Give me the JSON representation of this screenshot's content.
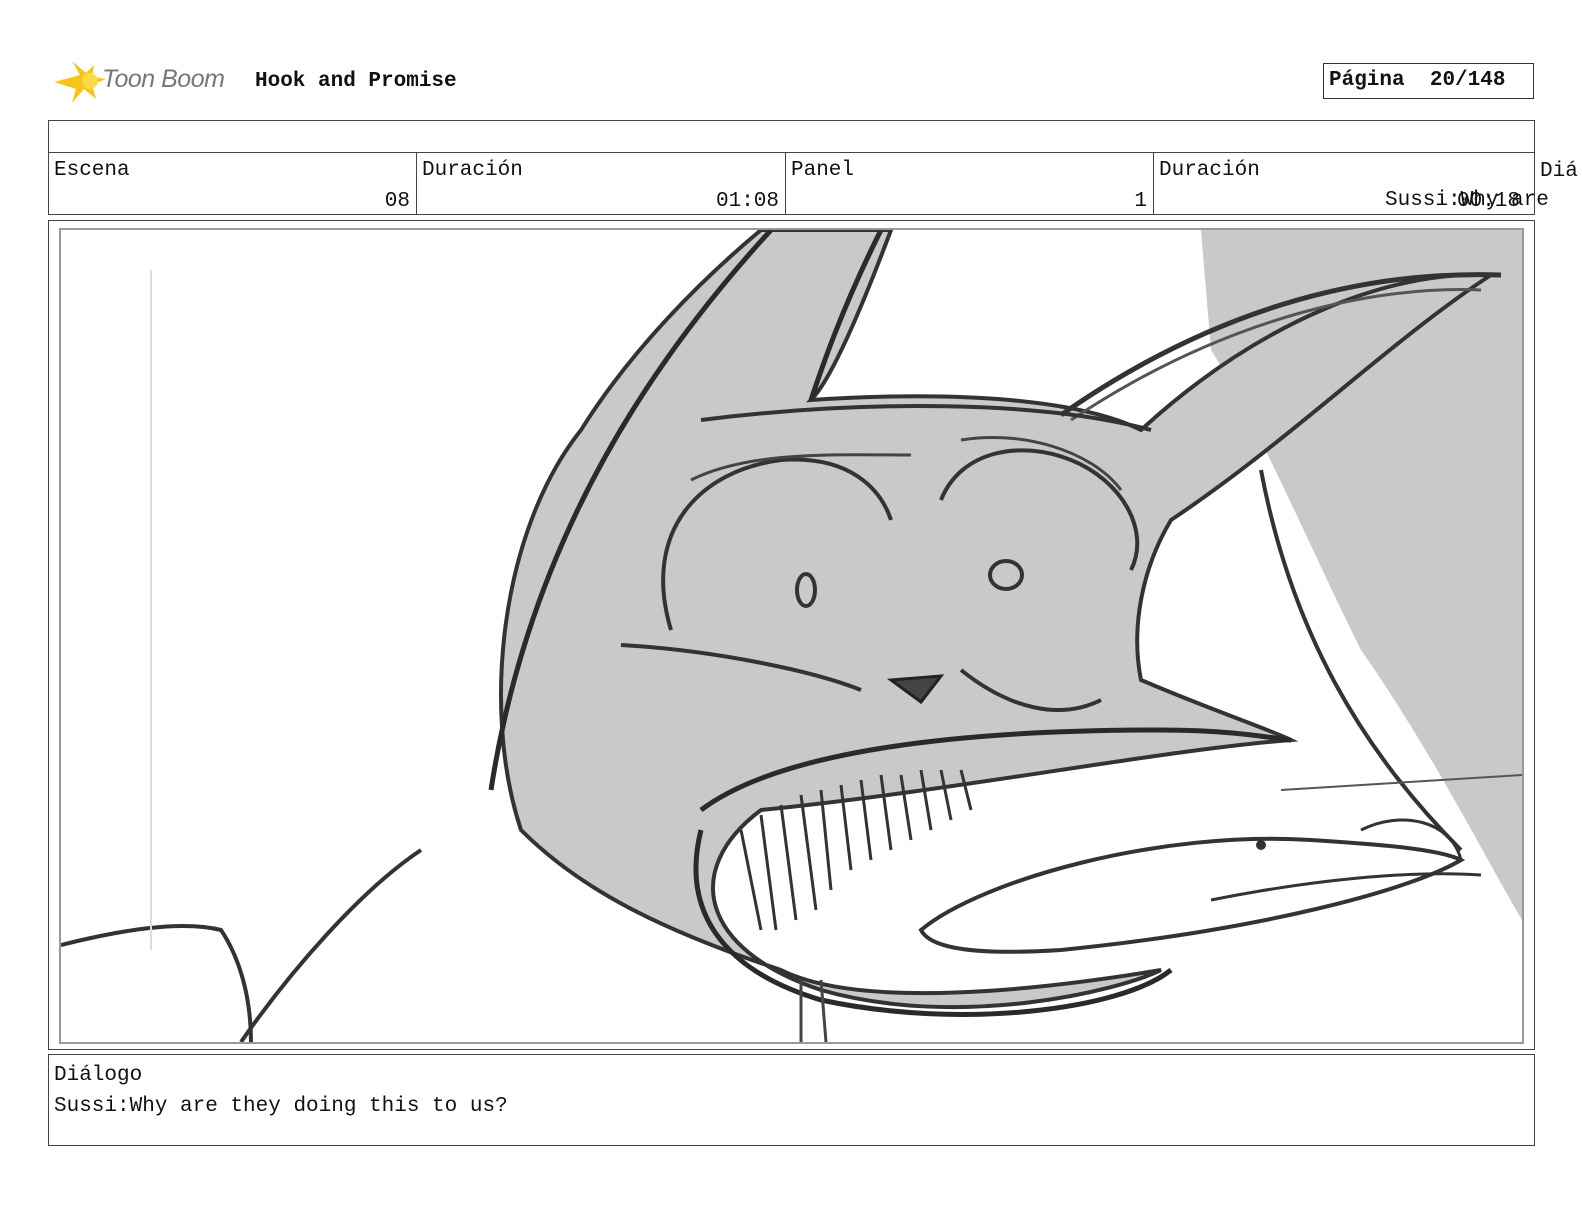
{
  "header": {
    "logo_text": "Toon Boom",
    "project_title": "Hook and Promise",
    "page_label": "Página",
    "page_value": "20/148"
  },
  "info": {
    "scene_label": "Escena",
    "scene_value": "08",
    "scene_duration_label": "Duración",
    "scene_duration_value": "01:08",
    "panel_label": "Panel",
    "panel_value": "1",
    "panel_duration_label": "Duración",
    "panel_duration_value": "00:18",
    "dialog_label_cut": "Diá",
    "dialog_overflow_1": "are",
    "dialog_overflow_2": "Sussi:Why"
  },
  "dialog": {
    "label": "Diálogo",
    "text": "Sussi:Why are they doing this to us?"
  },
  "colors": {
    "sketch_fill": "#c9c9c9",
    "sketch_line": "#3a3a3a",
    "logo_yellow": "#f5c518"
  }
}
